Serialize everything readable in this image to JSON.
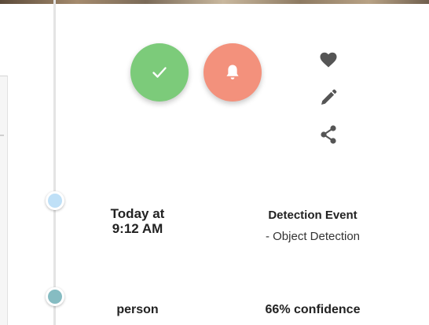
{
  "colors": {
    "approve": "#7ccb7a",
    "alert": "#f3917c",
    "timeline_dot_event": "#bfe0f7",
    "timeline_dot_detection": "#86bcc2",
    "icon": "#555555"
  },
  "icons": {
    "approve": "check-icon",
    "alert": "bell-icon",
    "favorite": "heart-icon",
    "edit": "pencil-icon",
    "share": "share-icon"
  },
  "event": {
    "time": "Today at\n9:12 AM",
    "title": "Detection Event",
    "subtitle": "- Object Detection"
  },
  "detection": {
    "label": "person",
    "confidence": "66% confidence"
  }
}
